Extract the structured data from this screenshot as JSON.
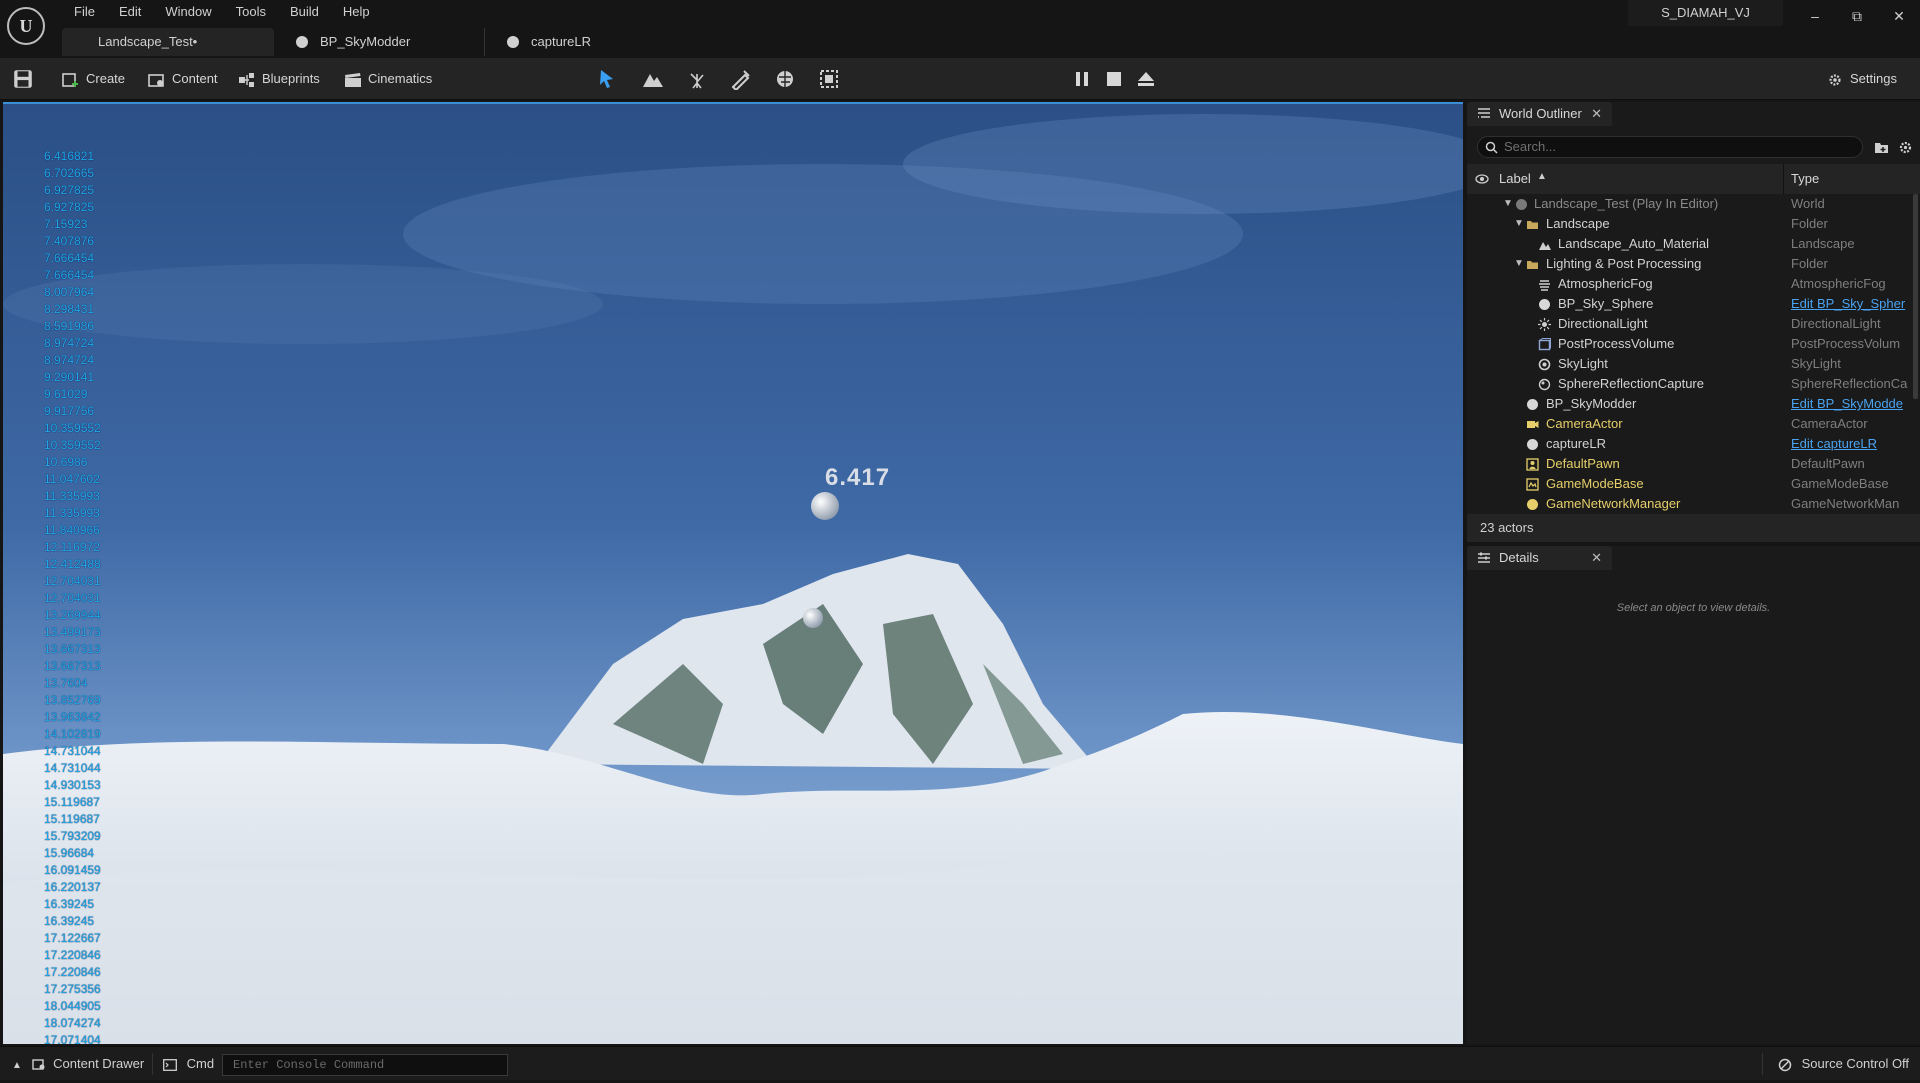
{
  "menubar": {
    "logo": "U",
    "items": [
      "File",
      "Edit",
      "Window",
      "Tools",
      "Build",
      "Help"
    ],
    "user": "S_DIAMAH_VJ"
  },
  "tabs": [
    {
      "label": "Landscape_Test•"
    },
    {
      "label": "BP_SkyModder"
    },
    {
      "label": "captureLR"
    }
  ],
  "toolbar": {
    "create": "Create",
    "content": "Content",
    "blueprints": "Blueprints",
    "cinematics": "Cinematics",
    "settings": "Settings"
  },
  "viewport": {
    "overlay_value": "6.417",
    "stats": [
      "6.416821",
      "6.702665",
      "6.927825",
      "6.927825",
      "7.15923",
      "7.407876",
      "7.666454",
      "7.666454",
      "8.007964",
      "8.298431",
      "8.591986",
      "8.974724",
      "8.974724",
      "9.290141",
      "9.61029",
      "9.917756",
      "10.359552",
      "10.359552",
      "10.6986",
      "11.047602",
      "11.335993",
      "11.335993",
      "11.840966",
      "12.116972",
      "12.412488",
      "12.704031",
      "12.704031",
      "13.269944",
      "13.499173",
      "13.667313",
      "13.667313",
      "13.7604",
      "13.852769",
      "13.963842",
      "14.102819",
      "14.731044",
      "14.731044",
      "14.930153",
      "15.119687",
      "15.119687",
      "15.793209",
      "15.96684",
      "16.091459",
      "16.220137",
      "16.39245",
      "16.39245",
      "17.122667",
      "17.220846",
      "17.220846",
      "17.275356",
      "18.044905",
      "18.074274",
      "17.071404"
    ],
    "accent": "#20a9e8"
  },
  "outliner": {
    "title": "World Outliner",
    "search_placeholder": "Search...",
    "col_label": "Label",
    "col_type": "Type",
    "rows": [
      {
        "label": "Landscape_Test (Play In Editor)",
        "type": "World"
      },
      {
        "label": "Landscape",
        "type": "Folder"
      },
      {
        "label": "Landscape_Auto_Material",
        "type": "Landscape"
      },
      {
        "label": "Lighting & Post Processing",
        "type": "Folder"
      },
      {
        "label": "AtmosphericFog",
        "type": "AtmosphericFog"
      },
      {
        "label": "BP_Sky_Sphere",
        "type": "Edit BP_Sky_Spher"
      },
      {
        "label": "DirectionalLight",
        "type": "DirectionalLight"
      },
      {
        "label": "PostProcessVolume",
        "type": "PostProcessVolum"
      },
      {
        "label": "SkyLight",
        "type": "SkyLight"
      },
      {
        "label": "SphereReflectionCapture",
        "type": "SphereReflectionCa"
      },
      {
        "label": "BP_SkyModder",
        "type": "Edit BP_SkyModde"
      },
      {
        "label": "CameraActor",
        "type": "CameraActor"
      },
      {
        "label": "captureLR",
        "type": "Edit captureLR"
      },
      {
        "label": "DefaultPawn",
        "type": "DefaultPawn"
      },
      {
        "label": "GameModeBase",
        "type": "GameModeBase"
      },
      {
        "label": "GameNetworkManager",
        "type": "GameNetworkMan"
      }
    ],
    "actor_count": "23 actors"
  },
  "details": {
    "title": "Details",
    "empty_message": "Select an object to view details."
  },
  "statusbar": {
    "content_drawer": "Content Drawer",
    "cmd": "Cmd",
    "console_placeholder": "Enter Console Command",
    "source_control": "Source Control Off"
  }
}
